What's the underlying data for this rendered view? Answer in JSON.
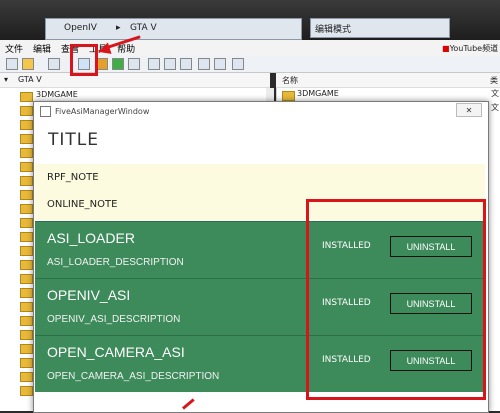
{
  "explorer": {
    "path_app": "OpenIV",
    "path_game": "GTA V",
    "mode_label": "编辑模式",
    "youtube_label": "YouTube频道"
  },
  "menu": {
    "items": [
      "文件",
      "编辑",
      "查看",
      "工具",
      "帮助"
    ]
  },
  "tree": {
    "header": "GTA V",
    "first_item": "3DMGAME"
  },
  "list": {
    "header": "名称",
    "first_item": "3DMGAME",
    "type_header": "类"
  },
  "dialog": {
    "window_title": "FiveAsiManagerWindow",
    "title": "TITLE",
    "rpf_note": "RPF_NOTE",
    "online_note": "ONLINE_NOTE",
    "close_glyph": "✕"
  },
  "asi_items": [
    {
      "name": "ASI_LOADER",
      "description": "ASI_LOADER_DESCRIPTION",
      "status": "INSTALLED",
      "button": "UNINSTALL"
    },
    {
      "name": "OPENIV_ASI",
      "description": "OPENIV_ASI_DESCRIPTION",
      "status": "INSTALLED",
      "button": "UNINSTALL"
    },
    {
      "name": "OPEN_CAMERA_ASI",
      "description": "OPEN_CAMERA_ASI_DESCRIPTION",
      "status": "INSTALLED",
      "button": "UNINSTALL"
    }
  ],
  "colors": {
    "asi_background": "#3d8a5b",
    "note_background": "#fcfbdf",
    "annotation_red": "#d9141b"
  }
}
